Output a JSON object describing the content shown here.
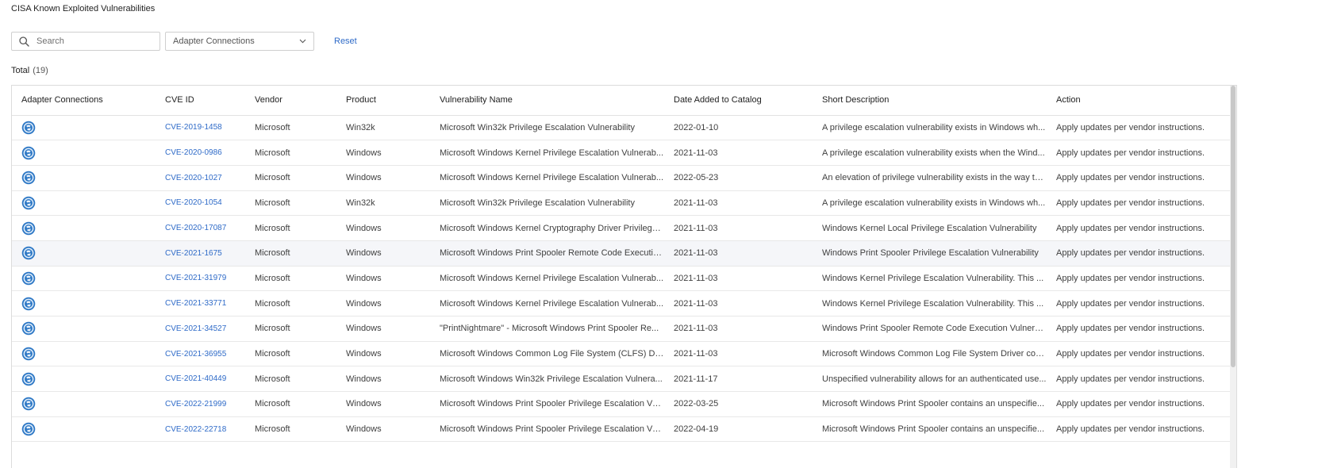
{
  "page": {
    "title": "CISA Known Exploited Vulnerabilities"
  },
  "toolbar": {
    "search_placeholder": "Search",
    "filter_value": "Adapter Connections",
    "reset_label": "Reset"
  },
  "summary": {
    "total_label": "Total",
    "total_count": "(19)"
  },
  "table": {
    "columns": [
      "Adapter Connections",
      "CVE ID",
      "Vendor",
      "Product",
      "Vulnerability Name",
      "Date Added to Catalog",
      "Short Description",
      "Action"
    ],
    "rows": [
      {
        "cve": "CVE-2019-1458",
        "vendor": "Microsoft",
        "product": "Win32k",
        "name": "Microsoft Win32k Privilege Escalation Vulnerability",
        "date": "2022-01-10",
        "desc": "A privilege escalation vulnerability exists in Windows wh...",
        "action": "Apply updates per vendor instructions."
      },
      {
        "cve": "CVE-2020-0986",
        "vendor": "Microsoft",
        "product": "Windows",
        "name": "Microsoft Windows Kernel Privilege Escalation Vulnerab...",
        "date": "2021-11-03",
        "desc": "A privilege escalation vulnerability exists when the Wind...",
        "action": "Apply updates per vendor instructions."
      },
      {
        "cve": "CVE-2020-1027",
        "vendor": "Microsoft",
        "product": "Windows",
        "name": "Microsoft Windows Kernel Privilege Escalation Vulnerab...",
        "date": "2022-05-23",
        "desc": "An elevation of privilege vulnerability exists in the way th...",
        "action": "Apply updates per vendor instructions."
      },
      {
        "cve": "CVE-2020-1054",
        "vendor": "Microsoft",
        "product": "Win32k",
        "name": "Microsoft Win32k Privilege Escalation Vulnerability",
        "date": "2021-11-03",
        "desc": "A privilege escalation vulnerability exists in Windows wh...",
        "action": "Apply updates per vendor instructions."
      },
      {
        "cve": "CVE-2020-17087",
        "vendor": "Microsoft",
        "product": "Windows",
        "name": "Microsoft Windows Kernel Cryptography Driver Privilege ...",
        "date": "2021-11-03",
        "desc": "Windows Kernel Local Privilege Escalation Vulnerability",
        "action": "Apply updates per vendor instructions."
      },
      {
        "cve": "CVE-2021-1675",
        "vendor": "Microsoft",
        "product": "Windows",
        "name": "Microsoft Windows Print Spooler Remote Code Executio...",
        "date": "2021-11-03",
        "desc": "Windows Print Spooler Privilege Escalation Vulnerability",
        "action": "Apply updates per vendor instructions."
      },
      {
        "cve": "CVE-2021-31979",
        "vendor": "Microsoft",
        "product": "Windows",
        "name": "Microsoft Windows Kernel Privilege Escalation Vulnerab...",
        "date": "2021-11-03",
        "desc": "Windows Kernel Privilege Escalation Vulnerability. This ...",
        "action": "Apply updates per vendor instructions."
      },
      {
        "cve": "CVE-2021-33771",
        "vendor": "Microsoft",
        "product": "Windows",
        "name": "Microsoft Windows Kernel Privilege Escalation Vulnerab...",
        "date": "2021-11-03",
        "desc": "Windows Kernel Privilege Escalation Vulnerability. This ...",
        "action": "Apply updates per vendor instructions."
      },
      {
        "cve": "CVE-2021-34527",
        "vendor": "Microsoft",
        "product": "Windows",
        "name": "\"PrintNightmare\" - Microsoft Windows Print Spooler Re...",
        "date": "2021-11-03",
        "desc": "Windows Print Spooler Remote Code Execution Vulnera...",
        "action": "Apply updates per vendor instructions."
      },
      {
        "cve": "CVE-2021-36955",
        "vendor": "Microsoft",
        "product": "Windows",
        "name": "Microsoft Windows Common Log File System (CLFS) Dr...",
        "date": "2021-11-03",
        "desc": "Microsoft Windows Common Log File System Driver con...",
        "action": "Apply updates per vendor instructions."
      },
      {
        "cve": "CVE-2021-40449",
        "vendor": "Microsoft",
        "product": "Windows",
        "name": "Microsoft Windows Win32k Privilege Escalation Vulnera...",
        "date": "2021-11-17",
        "desc": "Unspecified vulnerability allows for an authenticated use...",
        "action": "Apply updates per vendor instructions."
      },
      {
        "cve": "CVE-2022-21999",
        "vendor": "Microsoft",
        "product": "Windows",
        "name": "Microsoft Windows Print Spooler Privilege Escalation Vu...",
        "date": "2022-03-25",
        "desc": "Microsoft Windows Print Spooler contains an unspecifie...",
        "action": "Apply updates per vendor instructions."
      },
      {
        "cve": "CVE-2022-22718",
        "vendor": "Microsoft",
        "product": "Windows",
        "name": "Microsoft Windows Print Spooler Privilege Escalation Vu...",
        "date": "2022-04-19",
        "desc": "Microsoft Windows Print Spooler contains an unspecifie...",
        "action": "Apply updates per vendor instructions."
      }
    ],
    "highlighted_row": 5
  },
  "icons": {
    "search": "search-icon",
    "dropdown": "chevron-down-icon",
    "adapter": "adapter-globe-icon"
  },
  "colors": {
    "link": "#2f6bc8",
    "row_highlight": "#f5f6f9",
    "adapter_icon": "#2f79c6"
  }
}
